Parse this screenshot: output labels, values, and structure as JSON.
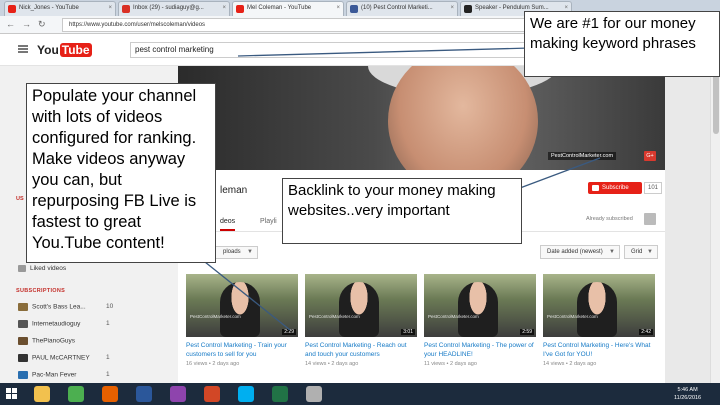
{
  "browser": {
    "tabs": [
      {
        "label": "Nick_Jones - YouTube",
        "color": "#e62117",
        "active": false
      },
      {
        "label": "Inbox (29) - sudiaguy@g...",
        "color": "#d93025",
        "active": false
      },
      {
        "label": "Mel Coleman - YouTube",
        "color": "#e62117",
        "active": true
      },
      {
        "label": "(10) Pest Control Marketi...",
        "color": "#3b5998",
        "active": false
      },
      {
        "label": "Speaker - Pendulum Sum...",
        "color": "#222222",
        "active": false
      }
    ],
    "url": "https://www.youtube.com/user/melscoleman/videos"
  },
  "youtube": {
    "logo_you": "You",
    "logo_tube": "Tube",
    "search_value": "pest control marketing"
  },
  "sidebar": {
    "fragment": "US",
    "liked_label": "Liked videos",
    "subscriptions_heading": "SUBSCRIPTIONS",
    "subscriptions": [
      {
        "name": "Scott's Bass Lea...",
        "count": "10",
        "color": "#8a6d3b"
      },
      {
        "name": "Internetaudioguy",
        "count": "1",
        "color": "#555555"
      },
      {
        "name": "ThePianoGuys",
        "count": "",
        "color": "#6b4f2f"
      },
      {
        "name": "PAUL McCARTNEY",
        "count": "1",
        "color": "#333333"
      },
      {
        "name": "Pac-Man Fever",
        "count": "1",
        "color": "#2a6fb0"
      }
    ]
  },
  "channel": {
    "banner_link": "PestControlMarketer.com",
    "banner_social": "G+",
    "name_fragment": "leman",
    "subscribe_label": "Subscribe",
    "subscriber_count": "101",
    "already_subscribed": "Already subscribed",
    "tab_videos": "deos",
    "tab_playlists": "Playli",
    "uploads_label": "ploads",
    "sort_label": "Date added (newest)",
    "view_label": "Grid"
  },
  "videos": [
    {
      "title": "Pest Control Marketing - Train your customers to sell for you",
      "views": "16 views",
      "age": "2 days ago",
      "duration": "2:29",
      "watermark": "PestControlMarketer.com"
    },
    {
      "title": "Pest Control Marketing - Reach out and touch your customers",
      "views": "14 views",
      "age": "2 days ago",
      "duration": "3:01",
      "watermark": "PestControlMarketer.com"
    },
    {
      "title": "Pest Control Marketing - The power of your HEADLINE!",
      "views": "11 views",
      "age": "2 days ago",
      "duration": "2:59",
      "watermark": "PestControlMarketer.com"
    },
    {
      "title": "Pest Control Marketing - Here's What I've Got for YOU!",
      "views": "14 views",
      "age": "2 days ago",
      "duration": "2:42",
      "watermark": "PestControlMarketer.com"
    }
  ],
  "taskbar": {
    "time": "5:46 AM",
    "date": "11/26/2016",
    "apps": [
      {
        "name": "file-explorer",
        "color": "#f2c14e"
      },
      {
        "name": "chrome",
        "color": "#4caf50"
      },
      {
        "name": "firefox",
        "color": "#e66000"
      },
      {
        "name": "word",
        "color": "#2b579a"
      },
      {
        "name": "media",
        "color": "#8e44ad"
      },
      {
        "name": "powerpoint",
        "color": "#d24726"
      },
      {
        "name": "skype",
        "color": "#00aff0"
      },
      {
        "name": "excel",
        "color": "#217346"
      },
      {
        "name": "photos",
        "color": "#b0b0b0"
      }
    ]
  },
  "annotations": {
    "keyword": "We are #1 for our money making keyword phrases",
    "populate": "Populate your channel with lots of videos configured for ranking. Make videos anyway you can, but repurposing FB Live is fastest to great You.Tube content!",
    "backlink": "Backlink to your money making websites..very important"
  }
}
